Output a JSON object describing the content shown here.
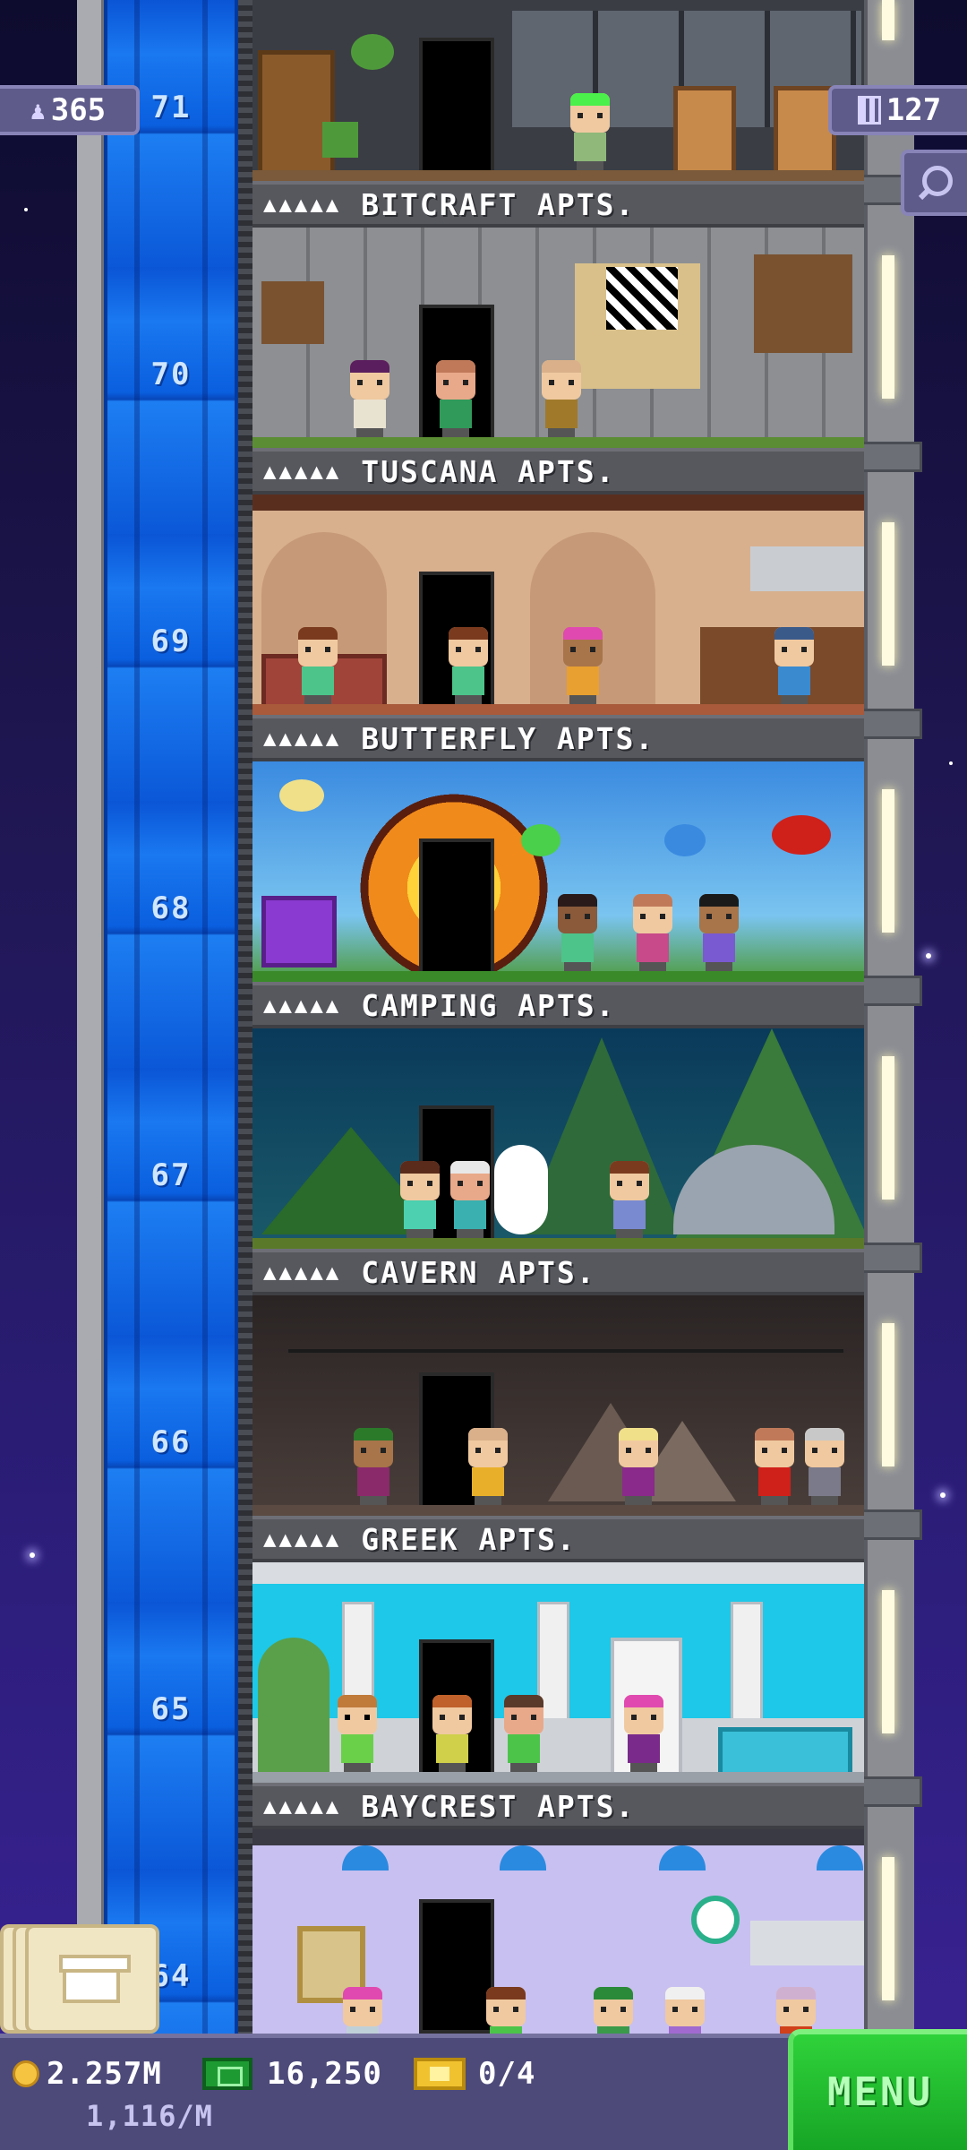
{
  "hud": {
    "population_icon": "person-icon",
    "population": "365",
    "floors_icon": "building-icon",
    "floors": "127",
    "search_icon": "magnifier-icon"
  },
  "floors": [
    {
      "number": "71",
      "name": "BITCRAFT APTS.",
      "resident_icons": "▲▲▲▲▲"
    },
    {
      "number": "70",
      "name": "TUSCANA APTS.",
      "resident_icons": "▲▲▲▲▲"
    },
    {
      "number": "69",
      "name": "BUTTERFLY APTS.",
      "resident_icons": "▲▲▲▲▲"
    },
    {
      "number": "68",
      "name": "CAMPING APTS.",
      "resident_icons": "▲▲▲▲▲"
    },
    {
      "number": "67",
      "name": "CAVERN APTS.",
      "resident_icons": "▲▲▲▲▲"
    },
    {
      "number": "66",
      "name": "GREEK APTS.",
      "resident_icons": "▲▲▲▲▲"
    },
    {
      "number": "65",
      "name": "BAYCREST APTS.",
      "resident_icons": "▲▲▲▲▲"
    },
    {
      "number": "64"
    }
  ],
  "bottom_bar": {
    "coins": "2.257M",
    "coins_rate": "1,116/M",
    "bux": "16,250",
    "tickets": "0/4",
    "menu_label": "MENU"
  },
  "colors": {
    "shaft": "#1a78f0",
    "menu": "#2fd23a",
    "hud": "#5e5a8a"
  }
}
